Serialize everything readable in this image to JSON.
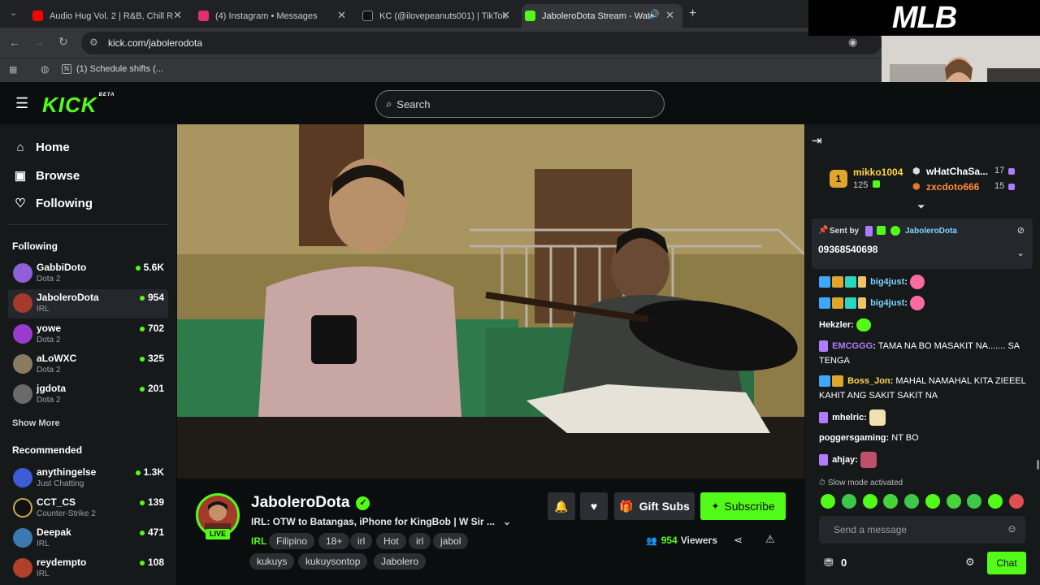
{
  "browser": {
    "tabs": [
      {
        "title": "Audio Hug Vol. 2 | R&B, Chill R",
        "icon_color": "#ff0000"
      },
      {
        "title": "(4) Instagram • Messages",
        "icon_color": "#e1306c"
      },
      {
        "title": "KC (@ilovepeanuts001) | TikTok",
        "icon_color": "#111111"
      },
      {
        "title": "JaboleroDota Stream - Wat",
        "icon_color": "#53fc18"
      }
    ],
    "url": "kick.com/jabolerodota",
    "bookmark": "(1) Schedule shifts (..."
  },
  "overlay": {
    "logo": "MLB"
  },
  "kick": {
    "logo": "KICK",
    "beta": "BETA",
    "search_placeholder": "Search",
    "accent": "#53fc18"
  },
  "sidebar": {
    "nav": [
      {
        "label": "Home",
        "icon": "home-icon"
      },
      {
        "label": "Browse",
        "icon": "browse-icon"
      },
      {
        "label": "Following",
        "icon": "heart-icon"
      }
    ],
    "following_title": "Following",
    "following": [
      {
        "name": "GabbiDoto",
        "category": "Dota 2",
        "viewers": "5.6K",
        "color": "#8f5fd6"
      },
      {
        "name": "JaboleroDota",
        "category": "IRL",
        "viewers": "954",
        "color": "#a33a2a"
      },
      {
        "name": "yowe",
        "category": "Dota 2",
        "viewers": "702",
        "color": "#9a3bd0"
      },
      {
        "name": "aLoWXC",
        "category": "Dota 2",
        "viewers": "325",
        "color": "#8a7a60"
      },
      {
        "name": "jgdota",
        "category": "Dota 2",
        "viewers": "201",
        "color": "#6a6a6a"
      }
    ],
    "show_more": "Show More",
    "recommended_title": "Recommended",
    "recommended": [
      {
        "name": "anythingelse",
        "category": "Just Chatting",
        "viewers": "1.3K",
        "color": "#3d5bd6"
      },
      {
        "name": "CCT_CS",
        "category": "Counter-Strike 2",
        "viewers": "139",
        "color": "#c8a94b"
      },
      {
        "name": "Deepak",
        "category": "IRL",
        "viewers": "471",
        "color": "#3a7ab0"
      },
      {
        "name": "reydempto",
        "category": "IRL",
        "viewers": "108",
        "color": "#b0402a"
      }
    ]
  },
  "stream": {
    "channel": "JaboleroDota",
    "live_label": "LIVE",
    "title": "IRL: OTW to Batangas, iPhone for KingBob | W Sir ...",
    "category": "IRL",
    "tags": [
      "Filipino",
      "18+",
      "irl",
      "Hot",
      "irl",
      "jabol",
      "kukuys",
      "kukuysontop",
      "Jabolero"
    ],
    "viewers": "954",
    "viewers_label": "Viewers",
    "gift_subs": "Gift Subs",
    "subscribe": "Subscribe"
  },
  "chat": {
    "top_gifters": [
      {
        "rank": "1",
        "name": "mikko1004",
        "count": "125"
      },
      {
        "name": "wHatChaSa...",
        "count": "17"
      },
      {
        "name": "zxcdoto666",
        "count": "15"
      }
    ],
    "pinned": {
      "sent_by_label": "Sent by",
      "sender": "JaboleroDota",
      "message": "09368540698"
    },
    "messages": [
      {
        "user": "big4just",
        "text": "",
        "user_color": "#3ea8ff"
      },
      {
        "user": "big4just",
        "text": "",
        "user_color": "#3ea8ff"
      },
      {
        "user": "Hekzler",
        "text": "",
        "user_color": "#ffffff"
      },
      {
        "user": "EMCGGG",
        "text": "TAMA NA BO MASAKIT NA....... SA TENGA",
        "user_color": "#b07cff"
      },
      {
        "user": "Boss_Jon",
        "text": "MAHAL NAMAHAL KITA ZIEEEL KAHIT ANG SAKIT SAKIT NA",
        "user_color": "#ffd84a"
      },
      {
        "user": "mhelric",
        "text": "",
        "user_color": "#ffffff"
      },
      {
        "user": "poggersgaming",
        "text": "NT BO",
        "user_color": "#ffffff"
      },
      {
        "user": "ahjay",
        "text": "",
        "user_color": "#ffffff"
      }
    ],
    "slow_mode": "Slow mode activated",
    "input_placeholder": "Send a message",
    "points": "0",
    "chat_button": "Chat"
  }
}
